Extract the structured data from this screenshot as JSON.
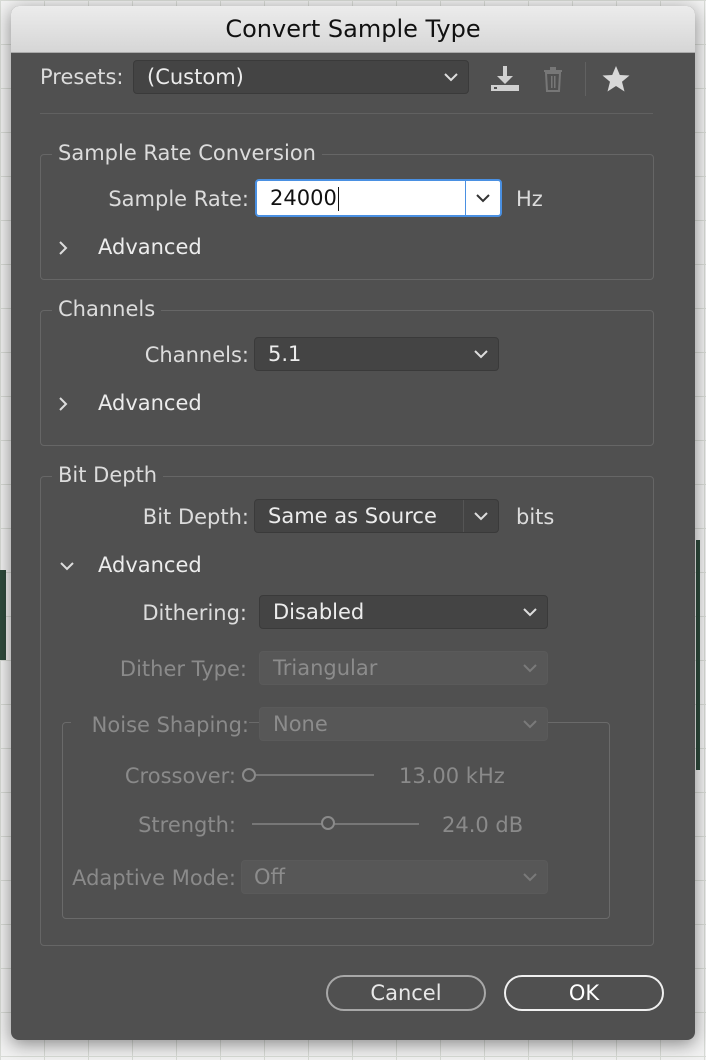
{
  "dialog": {
    "title": "Convert Sample Type"
  },
  "presets": {
    "label": "Presets:",
    "value": "(Custom)",
    "icons": [
      "download-icon",
      "trash-icon",
      "star-icon"
    ]
  },
  "sample_rate": {
    "section_title": "Sample Rate Conversion",
    "label": "Sample Rate:",
    "value": "24000",
    "unit": "Hz",
    "advanced": "Advanced"
  },
  "channels": {
    "section_title": "Channels",
    "label": "Channels:",
    "value": "5.1",
    "advanced": "Advanced"
  },
  "bit_depth": {
    "section_title": "Bit Depth",
    "label": "Bit Depth:",
    "value": "Same as Source",
    "unit": "bits",
    "advanced": "Advanced",
    "dithering": {
      "label": "Dithering:",
      "value": "Disabled"
    },
    "dither_type": {
      "label": "Dither Type:",
      "value": "Triangular"
    },
    "noise_shaping": {
      "label": "Noise Shaping:",
      "value": "None"
    },
    "crossover": {
      "label": "Crossover:",
      "value": "13.00 kHz",
      "position": 0.0
    },
    "strength": {
      "label": "Strength:",
      "value": "24.0 dB",
      "position": 0.47
    },
    "adaptive_mode": {
      "label": "Adaptive Mode:",
      "value": "Off"
    }
  },
  "buttons": {
    "cancel": "Cancel",
    "ok": "OK"
  },
  "colors": {
    "focus": "#4a90e2",
    "panel": "#505050"
  }
}
